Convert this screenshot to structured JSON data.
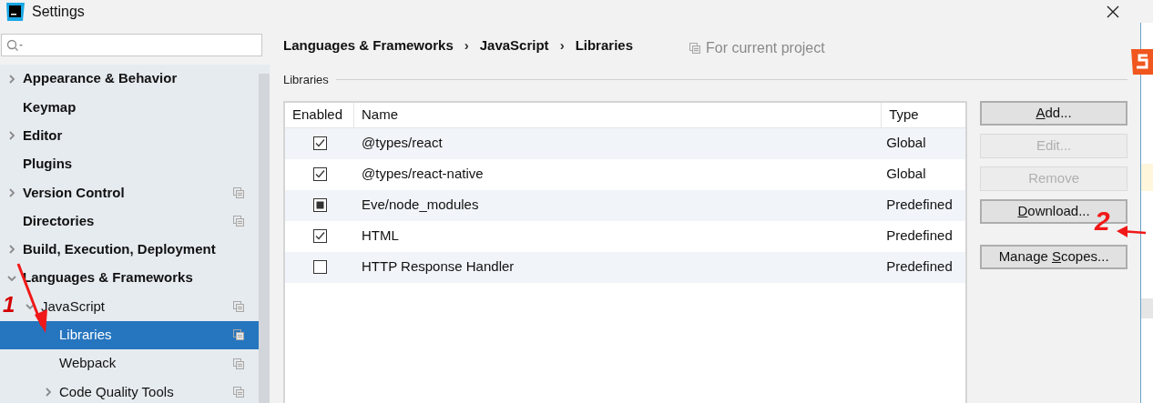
{
  "window": {
    "title": "Settings"
  },
  "sidebar": {
    "items": [
      {
        "label": "Appearance & Behavior",
        "expanded": false,
        "scope_icon": false,
        "selected": false
      },
      {
        "label": "Keymap",
        "scope_icon": false,
        "selected": false
      },
      {
        "label": "Editor",
        "expanded": false,
        "scope_icon": false,
        "selected": false
      },
      {
        "label": "Plugins",
        "scope_icon": false,
        "selected": false
      },
      {
        "label": "Version Control",
        "expanded": false,
        "scope_icon": true,
        "selected": false
      },
      {
        "label": "Directories",
        "scope_icon": true,
        "selected": false
      },
      {
        "label": "Build, Execution, Deployment",
        "expanded": false,
        "scope_icon": false,
        "selected": false
      },
      {
        "label": "Languages & Frameworks",
        "expanded": true,
        "scope_icon": false,
        "selected": false,
        "children": [
          {
            "label": "JavaScript",
            "expanded": true,
            "scope_icon": true,
            "selected": false,
            "children": [
              {
                "label": "Libraries",
                "scope_icon": true,
                "selected": true
              },
              {
                "label": "Webpack",
                "scope_icon": true,
                "selected": false
              },
              {
                "label": "Code Quality Tools",
                "expanded": false,
                "scope_icon": true,
                "selected": false
              }
            ]
          }
        ]
      }
    ]
  },
  "breadcrumb": [
    {
      "kind": "item",
      "text": "Languages & Frameworks"
    },
    {
      "kind": "separator",
      "text": "›"
    },
    {
      "kind": "item",
      "text": "JavaScript"
    },
    {
      "kind": "separator",
      "text": "›"
    },
    {
      "kind": "item",
      "text": "Libraries"
    }
  ],
  "scope_note": "For current project",
  "section": {
    "title": "Libraries"
  },
  "table": {
    "columns": [
      "Enabled",
      "Name",
      "Type"
    ],
    "rows": [
      {
        "checked": true,
        "indeterminate": false,
        "name": "@types/react",
        "type": "Global"
      },
      {
        "checked": true,
        "indeterminate": false,
        "name": "@types/react-native",
        "type": "Global"
      },
      {
        "checked": false,
        "indeterminate": true,
        "name": "Eve/node_modules",
        "type": "Predefined"
      },
      {
        "checked": true,
        "indeterminate": false,
        "name": "HTML",
        "type": "Predefined"
      },
      {
        "checked": false,
        "indeterminate": false,
        "name": "HTTP Response Handler",
        "type": "Predefined"
      }
    ]
  },
  "buttons": [
    {
      "key": "A",
      "after": "dd...",
      "disabled": false
    },
    {
      "before": "Edit...",
      "disabled": true
    },
    {
      "before": "Remove",
      "disabled": true
    },
    {
      "key": "D",
      "after": "ownload...",
      "disabled": false
    },
    {
      "before": "Manage ",
      "key": "S",
      "after": "copes...",
      "disabled": false
    }
  ],
  "annotations": [
    {
      "text": "1"
    },
    {
      "text": "2"
    }
  ]
}
